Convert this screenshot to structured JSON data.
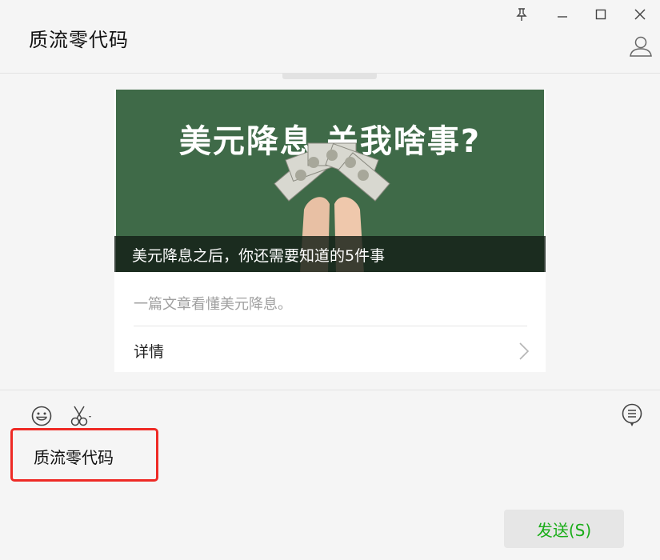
{
  "window": {
    "chat_title": "质流零代码",
    "controls": {
      "pin_icon": "pin-icon",
      "minimize_icon": "minimize-icon",
      "maximize_icon": "maximize-icon",
      "close_icon": "close-icon",
      "profile_icon": "user-profile-icon"
    }
  },
  "messages": [
    {
      "type": "article-card",
      "cover_banner": "美元降息 关我啥事?",
      "title": "美元降息之后，你还需要知道的5件事",
      "summary": "一篇文章看懂美元降息。",
      "details_label": "详情",
      "cover_color": "#3f6a48"
    }
  ],
  "input": {
    "tools": {
      "emoji_icon": "emoji-icon",
      "screenshot_icon": "scissors-icon",
      "history_icon": "chat-history-icon"
    },
    "text": "质流零代码",
    "send_label": "发送(S)",
    "send_color": "#1aad19",
    "highlight_color": "#ee2a25"
  }
}
